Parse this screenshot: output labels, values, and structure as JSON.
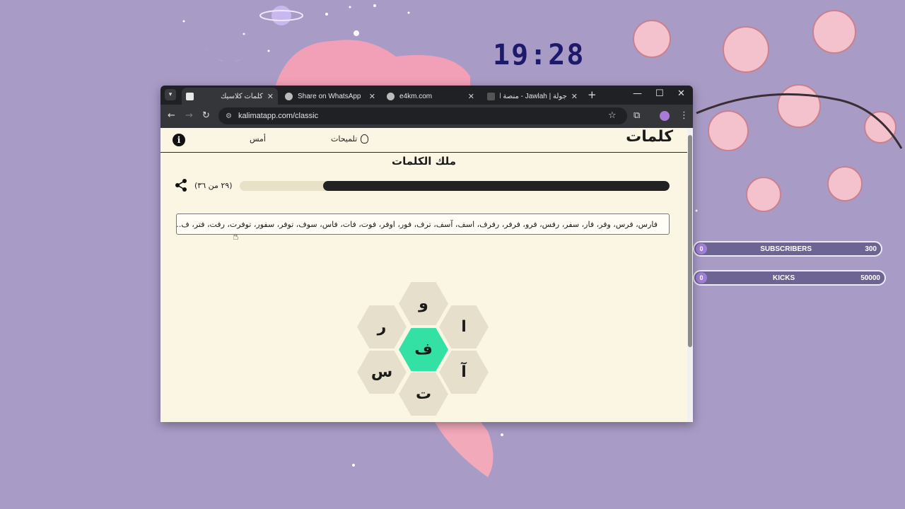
{
  "desktop": {
    "clock": "19:28",
    "widgets": [
      {
        "label": "SUBSCRIBERS",
        "current": "0",
        "goal": "300"
      },
      {
        "label": "KICKS",
        "current": "0",
        "goal": "50000"
      }
    ]
  },
  "browser": {
    "tabs": [
      {
        "title": "كلمات كلاسيك",
        "active": true
      },
      {
        "title": "Share on WhatsApp",
        "active": false
      },
      {
        "title": "e4km.com",
        "active": false
      },
      {
        "title": "جولة | Jawlah - منصة الألـ",
        "active": false
      }
    ],
    "url": "kalimatapp.com/classic"
  },
  "page": {
    "brand": "كلمات",
    "hints_label": "تلميحات",
    "yesterday_label": "أمس",
    "info_glyph": "i",
    "rank_title": "ملك الكلمات",
    "progress_text": "(٢٩ من ٣٦)",
    "progress_fraction": 0.806,
    "found_words": "فارس، فرس، وفر، فار، سفر، رفس، فرو، فرفر، رفرف، اسف، آسف، ترف، فور، اوفر، فوت، فات، فاس، سوف، توفر، سفور، توفرت، رفت، فتر، ف...",
    "letters": {
      "center": "ف",
      "top": "و",
      "top_right": "ا",
      "bottom_right": "آ",
      "bottom": "ت",
      "bottom_left": "س",
      "top_left": "ر"
    }
  },
  "colors": {
    "desktop_bg": "#a89bc6",
    "page_bg": "#fbf6e3",
    "center_cell": "#33e1a4",
    "outer_cell": "#e5dfcc",
    "progress_fill": "#222222"
  }
}
